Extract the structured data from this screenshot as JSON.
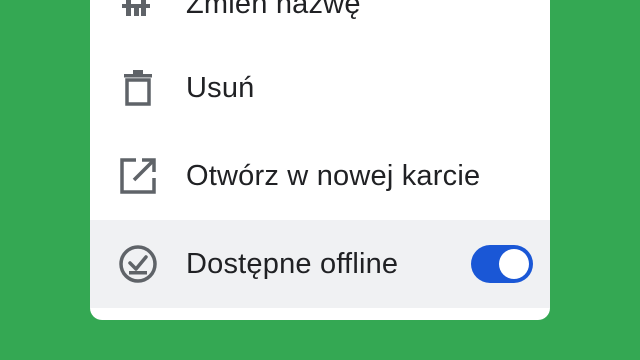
{
  "menu": {
    "items": [
      {
        "label": "Zmień nazwę",
        "icon": "rename-icon"
      },
      {
        "label": "Usuń",
        "icon": "trash-icon"
      },
      {
        "label": "Otwórz w nowej karcie",
        "icon": "open-in-new-icon"
      },
      {
        "label": "Dostępne offline",
        "icon": "offline-check-icon",
        "toggle_on": true
      }
    ]
  },
  "colors": {
    "background": "#34a853",
    "menu_background": "#ffffff",
    "highlight_row": "#f0f1f3",
    "toggle_track": "#1a57d6",
    "text": "#202124",
    "icon": "#5f6368"
  }
}
